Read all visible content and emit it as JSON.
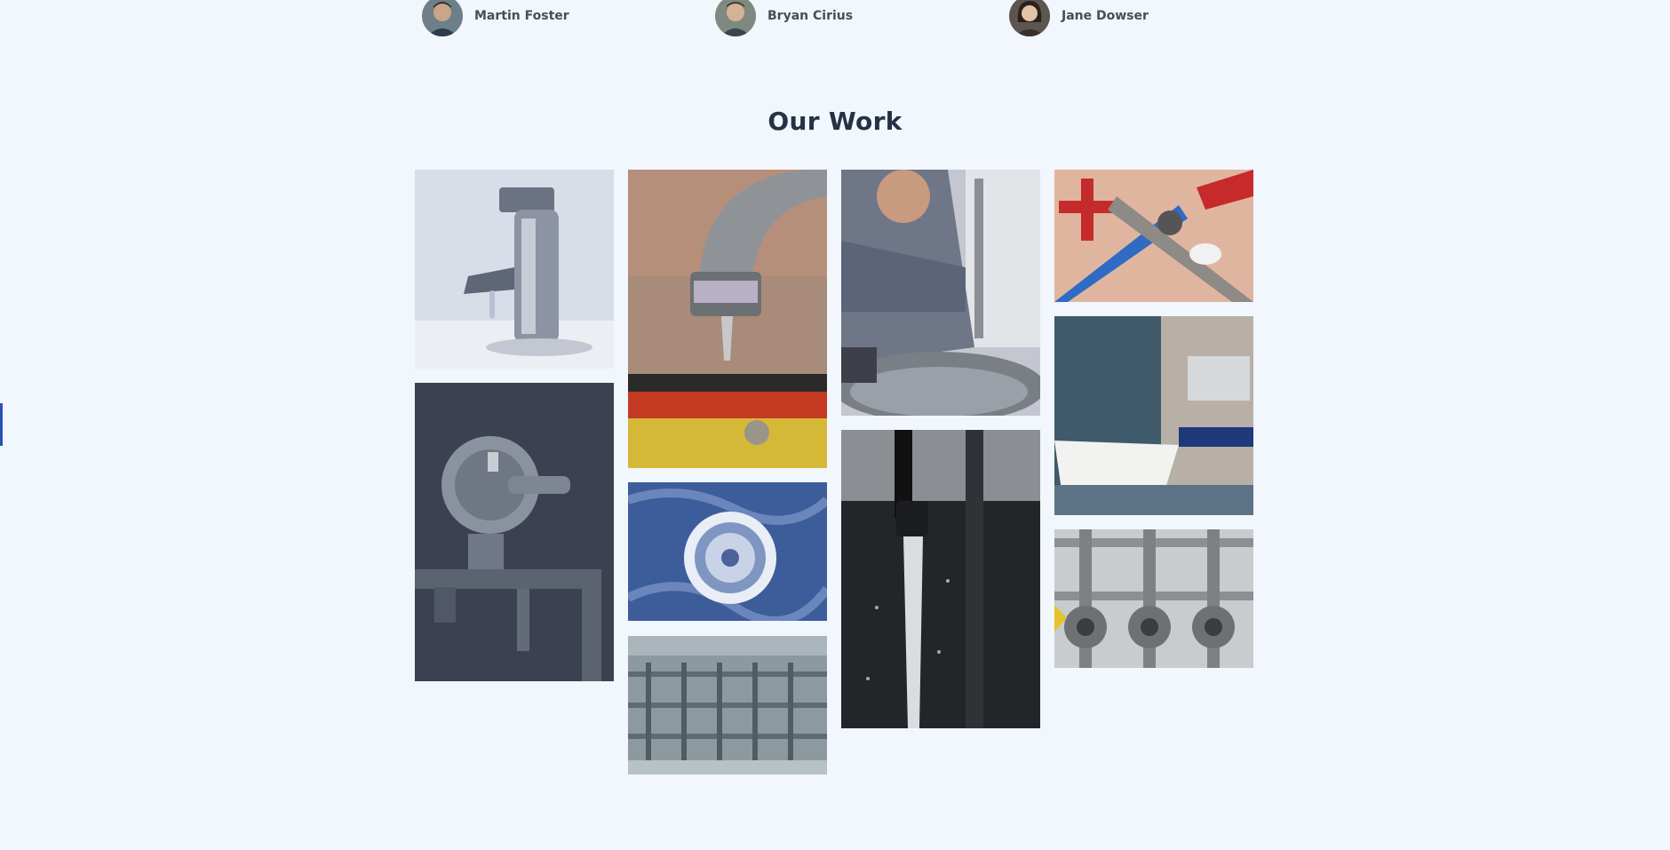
{
  "team": {
    "members": [
      {
        "name": "Martin Foster",
        "avatar_icon": "person-avatar-icon"
      },
      {
        "name": "Bryan Cirius",
        "avatar_icon": "person-avatar-icon"
      },
      {
        "name": "Jane Dowser",
        "avatar_icon": "person-avatar-icon"
      }
    ]
  },
  "work": {
    "title": "Our Work"
  },
  "colors": {
    "background": "#f2f6fd",
    "title": "#253245",
    "member_name": "#474d59",
    "accent_tab": "#2b53b6"
  }
}
